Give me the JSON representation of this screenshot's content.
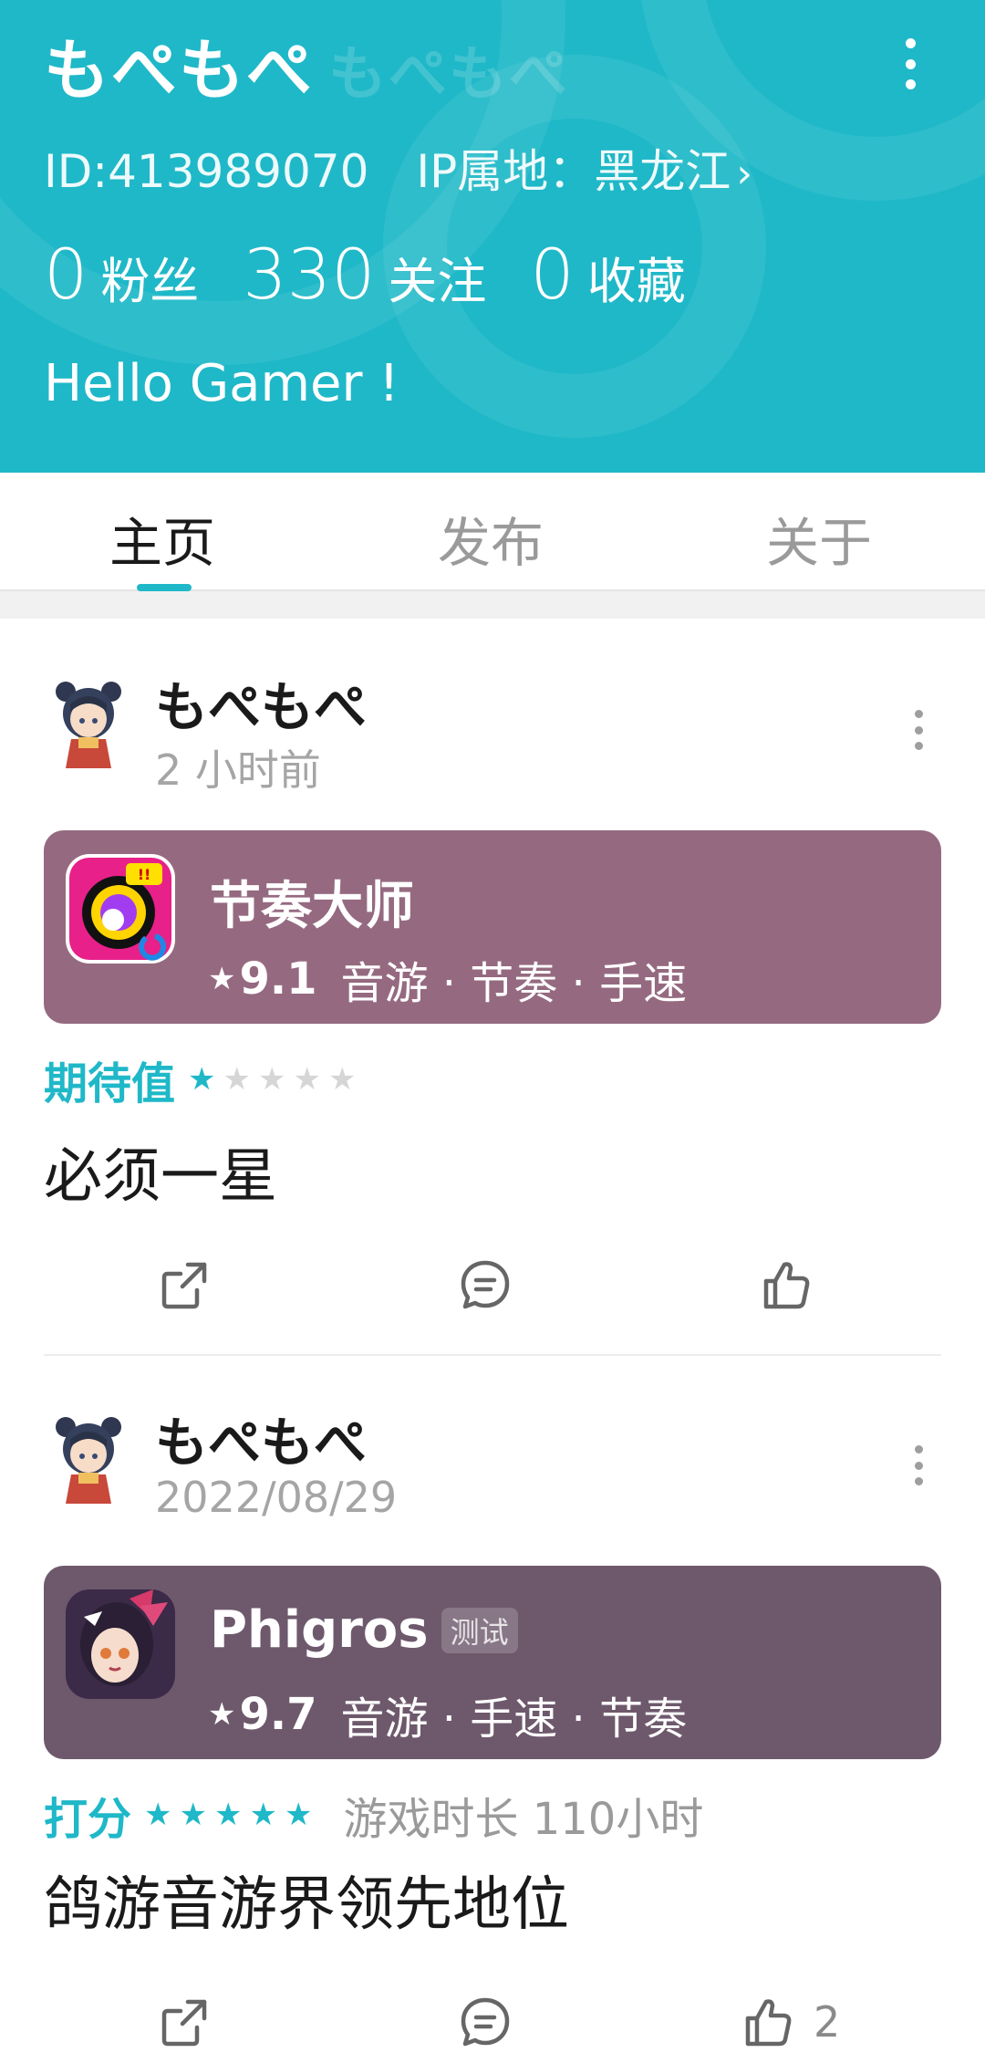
{
  "profile": {
    "username": "もぺもぺ",
    "id_label": "ID:413989070",
    "ip_label": "IP属地：黑龙江",
    "stats": [
      {
        "num": "0",
        "label": "粉丝"
      },
      {
        "num": "330",
        "label": "关注"
      },
      {
        "num": "0",
        "label": "收藏"
      }
    ],
    "bio": "Hello Gamer !"
  },
  "tabs": [
    {
      "label": "主页",
      "active": true
    },
    {
      "label": "发布",
      "active": false
    },
    {
      "label": "关于",
      "active": false
    }
  ],
  "posts": [
    {
      "author": "もぺもぺ",
      "time": "2 小时前",
      "game": {
        "title": "节奏大师",
        "badge": "",
        "score": "9.1",
        "tags": "音游 · 节奏 · 手速",
        "card_color": "#956a80"
      },
      "rating_label": "期待值",
      "stars": 1,
      "playtime": "",
      "text": "必须一星",
      "like_count": ""
    },
    {
      "author": "もぺもぺ",
      "time": "2022/08/29",
      "game": {
        "title": "Phigros",
        "badge": "测试",
        "score": "9.7",
        "tags": "音游 · 手速 · 节奏",
        "card_color": "#6e596c"
      },
      "rating_label": "打分",
      "stars": 5,
      "playtime": "游戏时长 110小时",
      "text": "鸽游音游界领先地位",
      "like_count": "2"
    }
  ],
  "icons": {
    "more": "more-vertical-icon",
    "share": "share-icon",
    "comment": "comment-icon",
    "like": "thumbs-up-icon",
    "star": "star-icon"
  },
  "colors": {
    "accent": "#1fb8c8",
    "star_off": "#d6d6d6"
  }
}
